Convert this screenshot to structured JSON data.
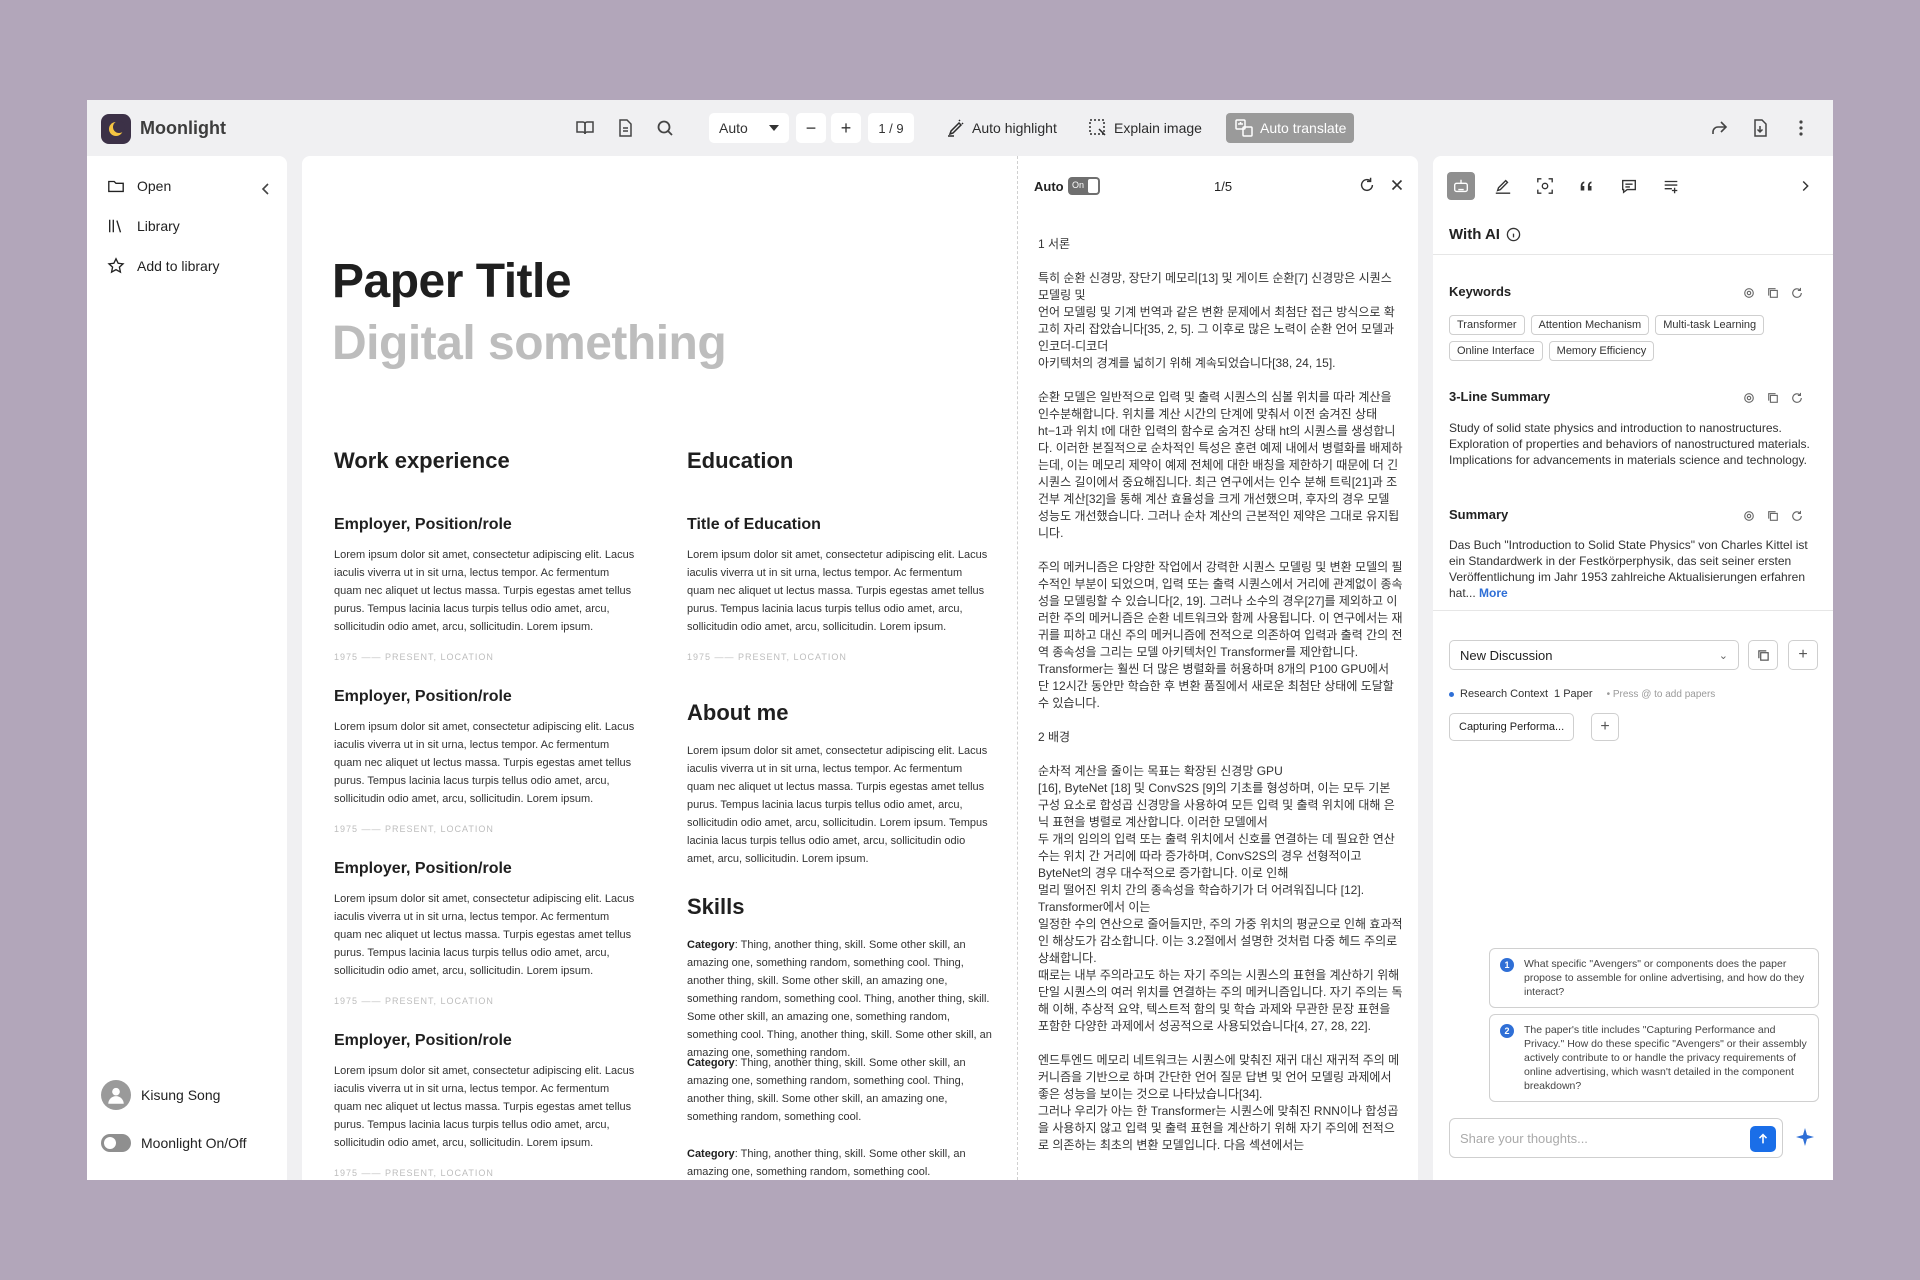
{
  "app": {
    "brand": "Moonlight"
  },
  "toolbar": {
    "zoom": "Auto",
    "zoom_out": "−",
    "zoom_in": "+",
    "page": "1 / 9",
    "auto_highlight": "Auto highlight",
    "explain_image": "Explain image",
    "auto_translate": "Auto translate"
  },
  "sidebar": {
    "items": [
      {
        "label": "Open",
        "icon": "folder-icon"
      },
      {
        "label": "Library",
        "icon": "library-icon"
      },
      {
        "label": "Add to library",
        "icon": "star-icon"
      }
    ],
    "user": "Kisung Song",
    "toggle_label": "Moonlight On/Off"
  },
  "paper": {
    "title": "Paper Title",
    "subtitle": "Digital something",
    "work_heading": "Work experience",
    "education_heading": "Education",
    "about_heading": "About me",
    "skills_heading": "Skills",
    "employer": "Employer, Position/role",
    "education_title": "Title of Education",
    "lorem": "Lorem ipsum dolor sit amet, consectetur adipiscing elit. Lacus iaculis viverra ut in sit urna, lectus tempor. Ac fermentum quam nec aliquet ut lectus massa. Turpis egestas amet tellus purus. Tempus lacinia lacus turpis tellus odio amet, arcu, sollicitudin odio amet, arcu, sollicitudin. Lorem ipsum.",
    "about": "Lorem ipsum dolor sit amet, consectetur adipiscing elit. Lacus iaculis viverra ut in sit urna, lectus tempor. Ac fermentum quam nec aliquet ut lectus massa. Turpis egestas amet tellus purus. Tempus lacinia lacus turpis tellus odio amet, arcu, sollicitudin odio amet, arcu, sollicitudin. Lorem ipsum. Tempus lacinia lacus turpis tellus odio amet, arcu, sollicitudin odio amet, arcu, sollicitudin. Lorem ipsum.",
    "meta": "1975 —— PRESENT, LOCATION",
    "skill_label": "Category",
    "skill_1": ": Thing, another thing, skill. Some other skill, an amazing one, something random, something cool. Thing, another thing, skill. Some other skill, an amazing one, something random, something cool. Thing, another thing, skill. Some other skill, an amazing one, something random, something cool. Thing, another thing, skill. Some other skill, an amazing one, something random.",
    "skill_2": ": Thing, another thing, skill. Some other skill, an amazing one, something random, something cool. Thing, another thing, skill. Some other skill, an amazing one, something random, something cool.",
    "skill_3": ": Thing, another thing, skill. Some other skill, an amazing one, something random, something cool."
  },
  "translation": {
    "auto_label": "Auto",
    "toggle_text": "On",
    "page": "1/5",
    "paragraphs": [
      "1 서론",
      "특히 순환 신경망, 장단기 메모리[13] 및 게이트 순환[7] 신경망은 시퀀스 모델링 및\n언어 모델링 및 기계 번역과 같은 변환 문제에서 최첨단 접근 방식으로 확고히 자리 잡았습니다[35, 2, 5]. 그 이후로 많은 노력이 순환 언어 모델과 인코더-디코더\n아키텍처의 경계를 넓히기 위해 계속되었습니다[38, 24, 15].",
      "순환 모델은 일반적으로 입력 및 출력 시퀀스의 심볼 위치를 따라 계산을 인수분해합니다. 위치를 계산 시간의 단계에 맞춰서 이전 숨겨진 상태 ht−1과 위치 t에 대한 입력의 함수로 숨겨진 상태 ht의 시퀀스를 생성합니다. 이러한 본질적으로 순차적인 특성은 훈련 예제 내에서 병렬화를 배제하는데, 이는 메모리 제약이 예제 전체에 대한 배칭을 제한하기 때문에 더 긴 시퀀스 길이에서 중요해집니다. 최근 연구에서는 인수 분해 트릭[21]과 조건부 계산[32]을 통해 계산 효율성을 크게 개선했으며, 후자의 경우 모델 성능도 개선했습니다. 그러나 순차 계산의 근본적인 제약은 그대로 유지됩니다.",
      "주의 메커니즘은 다양한 작업에서 강력한 시퀀스 모델링 및 변환 모델의 필수적인 부분이 되었으며, 입력 또는 출력 시퀀스에서 거리에 관계없이 종속성을 모델링할 수 있습니다[2, 19]. 그러나 소수의 경우[27]를 제외하고 이러한 주의 메커니즘은 순환 네트워크와 함께 사용됩니다. 이 연구에서는 재귀를 피하고 대신 주의 메커니즘에 전적으로 의존하여 입력과 출력 간의 전역 종속성을 그리는 모델 아키텍처인 Transformer를 제안합니다.\nTransformer는 훨씬 더 많은 병렬화를 허용하며 8개의 P100 GPU에서 단 12시간 동안만 학습한 후 변환 품질에서 새로운 최첨단 상태에 도달할 수 있습니다.",
      "2 배경",
      "순차적 계산을 줄이는 목표는 확장된 신경망 GPU\n[16], ByteNet [18] 및 ConvS2S [9]의 기초를 형성하며, 이는 모두 기본 구성 요소로 합성곱 신경망을 사용하여 모든 입력 및 출력 위치에 대해 은닉 표현을 병렬로 계산합니다. 이러한 모델에서\n두 개의 임의의 입력 또는 출력 위치에서 신호를 연결하는 데 필요한 연산 수는 위치 간 거리에 따라 증가하며, ConvS2S의 경우 선형적이고 ByteNet의 경우 대수적으로 증가합니다. 이로 인해\n멀리 떨어진 위치 간의 종속성을 학습하기가 더 어려워집니다 [12]. Transformer에서 이는\n일정한 수의 연산으로 줄어들지만, 주의 가중 위치의 평균으로 인해 효과적인 해상도가 감소합니다. 이는 3.2절에서 설명한 것처럼 다중 헤드 주의로 상쇄합니다.\n때로는 내부 주의라고도 하는 자기 주의는 시퀀스의 표현을 계산하기 위해 단일 시퀀스의 여러 위치를 연결하는 주의 메커니즘입니다. 자기 주의는 독해 이해, 추상적 요약, 텍스트적 함의 및 학습 과제와 무관한 문장 표현을 포함한 다양한 과제에서 성공적으로 사용되었습니다[4, 27, 28, 22].",
      "엔드투엔드 메모리 네트워크는 시퀀스에 맞춰진 재귀 대신 재귀적 주의 메커니즘을 기반으로 하며 간단한 언어 질문 답변 및 언어 모델링 과제에서 좋은 성능을 보이는 것으로 나타났습니다[34].\n그러나 우리가 아는 한 Transformer는 시퀀스에 맞춰진 RNN이나 합성곱을 사용하지 않고 입력 및 출력 표현을 계산하기 위해 자기 주의에 전적으로 의존하는 최초의 변환 모델입니다. 다음 섹션에서는"
    ]
  },
  "panel": {
    "with_ai": "With AI",
    "keywords_title": "Keywords",
    "keywords": [
      "Transformer",
      "Attention Mechanism",
      "Multi-task Learning",
      "Online Interface",
      "Memory Efficiency"
    ],
    "summary3_title": "3-Line Summary",
    "summary3": "Study of solid state physics and introduction to nanostructures. Exploration of properties and behaviors of nanostructured materials. Implications for advancements in materials science and technology.",
    "summary_title": "Summary",
    "summary": "Das Buch \"Introduction to Solid State Physics\" von Charles Kittel ist ein Standardwerk in der Festkörperphysik, das seit seiner ersten Veröffentlichung im Jahr 1953 zahlreiche Aktualisierungen erfahren hat...",
    "more": "More",
    "discussion": "New Discussion",
    "context_label": "Research Context",
    "context_count": "1 Paper",
    "context_hint": "• Press @ to add papers",
    "paper_chip": "Capturing Performa...",
    "questions": [
      {
        "num": "1",
        "text": "What specific \"Avengers\" or components does the paper propose to assemble for online advertising, and how do they interact?"
      },
      {
        "num": "2",
        "text": "The paper's title includes \"Capturing Performance and Privacy.\" How do these specific \"Avengers\" or their assembly actively contribute to or handle the privacy requirements of online advertising, which wasn't detailed in the component breakdown?"
      }
    ],
    "input_placeholder": "Share your thoughts..."
  },
  "colors": {
    "accent": "#2f6fd6",
    "send": "#1a6ee8",
    "background": "#b2a6ba",
    "logo": "#3c3147"
  }
}
